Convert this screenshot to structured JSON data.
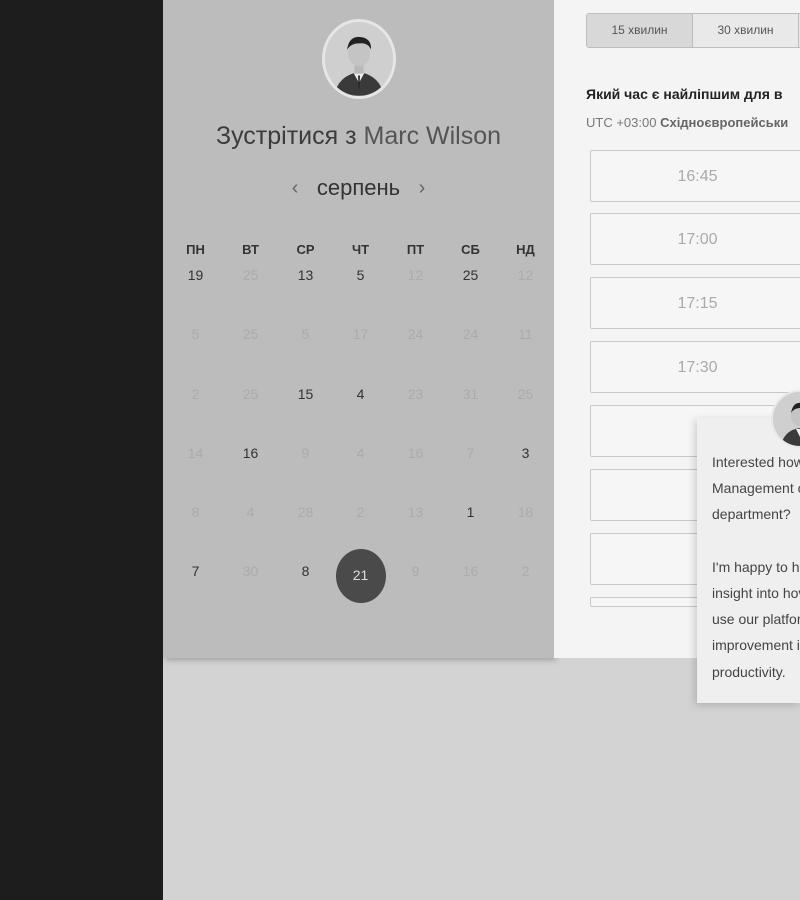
{
  "scheduler": {
    "title_prefix": "Зустрітися з",
    "host_name": "Marc Wilson",
    "month": "серпень",
    "prev_arrow": "‹",
    "next_arrow": "›",
    "weekdays": [
      "ПН",
      "ВТ",
      "СР",
      "ЧТ",
      "ПТ",
      "СБ",
      "НД"
    ],
    "weeks": [
      [
        {
          "d": "19",
          "on": true
        },
        {
          "d": "25",
          "on": false
        },
        {
          "d": "13",
          "on": true
        },
        {
          "d": "5",
          "on": true
        },
        {
          "d": "12",
          "on": false
        },
        {
          "d": "25",
          "on": true
        },
        {
          "d": "12",
          "on": false
        }
      ],
      [
        {
          "d": "5",
          "on": false
        },
        {
          "d": "25",
          "on": false
        },
        {
          "d": "5",
          "on": false
        },
        {
          "d": "17",
          "on": false
        },
        {
          "d": "24",
          "on": false
        },
        {
          "d": "24",
          "on": false
        },
        {
          "d": "11",
          "on": false
        }
      ],
      [
        {
          "d": "2",
          "on": false
        },
        {
          "d": "25",
          "on": false
        },
        {
          "d": "15",
          "on": true
        },
        {
          "d": "4",
          "on": true
        },
        {
          "d": "23",
          "on": false
        },
        {
          "d": "31",
          "on": false
        },
        {
          "d": "25",
          "on": false
        }
      ],
      [
        {
          "d": "14",
          "on": false
        },
        {
          "d": "16",
          "on": true
        },
        {
          "d": "9",
          "on": false
        },
        {
          "d": "4",
          "on": false
        },
        {
          "d": "16",
          "on": false
        },
        {
          "d": "7",
          "on": false
        },
        {
          "d": "3",
          "on": true
        }
      ],
      [
        {
          "d": "8",
          "on": false
        },
        {
          "d": "4",
          "on": false
        },
        {
          "d": "28",
          "on": false
        },
        {
          "d": "2",
          "on": false
        },
        {
          "d": "13",
          "on": false
        },
        {
          "d": "1",
          "on": true
        },
        {
          "d": "18",
          "on": false
        }
      ],
      [
        {
          "d": "7",
          "on": true
        },
        {
          "d": "30",
          "on": false
        },
        {
          "d": "8",
          "on": true
        },
        {
          "d": "21",
          "on": true,
          "selected": true
        },
        {
          "d": "9",
          "on": false
        },
        {
          "d": "16",
          "on": false
        },
        {
          "d": "2",
          "on": false
        }
      ]
    ]
  },
  "duration_tabs": [
    "15 хвилин",
    "30 хвилин",
    ""
  ],
  "time_question": "Який час є найліпшим для в",
  "timezone": {
    "offset": "UTC +03:00",
    "name": "Східноєвропейськи"
  },
  "slots": [
    "16:45",
    "17:00",
    "17:15",
    "17:30",
    "",
    "",
    ""
  ],
  "chat": {
    "lines": [
      "Interested how",
      "Management c",
      "department?",
      "",
      "I'm happy to he",
      "insight into hov",
      "use our platfor",
      "improvement i",
      "productivity."
    ]
  }
}
